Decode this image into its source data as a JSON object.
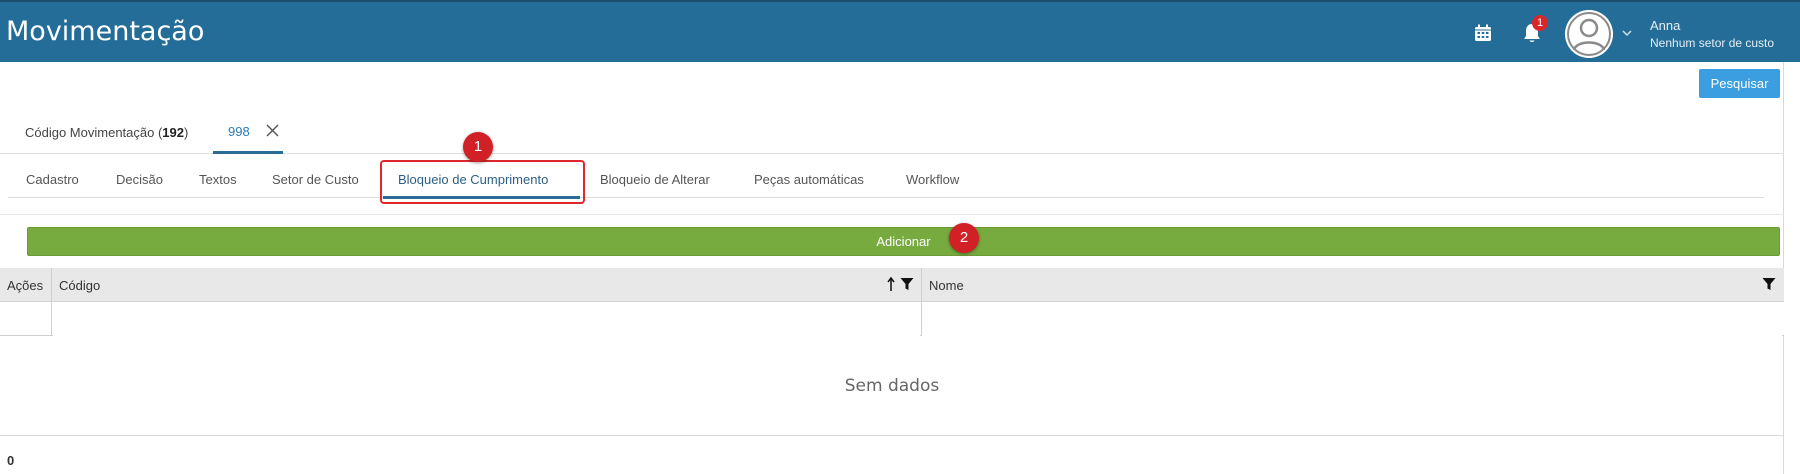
{
  "header": {
    "title": "Movimentação",
    "notifications_count": "1",
    "user": {
      "name": "Anna",
      "sector": "Nenhum setor de custo"
    }
  },
  "toolbar": {
    "search_label": "Pesquisar"
  },
  "doc_tabs": {
    "code_label": "Código Movimentação (",
    "code_value": "192",
    "code_suffix": ")",
    "record_label": "998"
  },
  "tabs": [
    {
      "label": "Cadastro"
    },
    {
      "label": "Decisão"
    },
    {
      "label": "Textos"
    },
    {
      "label": "Setor de Custo"
    },
    {
      "label": "Bloqueio de Cumprimento",
      "active": true
    },
    {
      "label": "Bloqueio de Alterar"
    },
    {
      "label": "Peças automáticas"
    },
    {
      "label": "Workflow"
    }
  ],
  "markers": [
    "1",
    "2"
  ],
  "actions": {
    "add_label": "Adicionar"
  },
  "grid": {
    "columns": [
      {
        "label": "Ações"
      },
      {
        "label": "Código",
        "sorted": "ascending",
        "filterable": true
      },
      {
        "label": "Nome",
        "filterable": true
      }
    ],
    "empty_text": "Sem dados",
    "total": "0"
  },
  "colors": {
    "header_bg": "#236d98",
    "primary_button": "#3a9ee0",
    "add_button": "#78ab3f",
    "annotation_red": "#d12026",
    "active_tab": "#2b6d96"
  },
  "icons": [
    "calendar-icon",
    "bell-icon",
    "user-avatar-icon",
    "chevron-down-icon",
    "close-icon",
    "sort-ascending-icon",
    "filter-icon"
  ]
}
